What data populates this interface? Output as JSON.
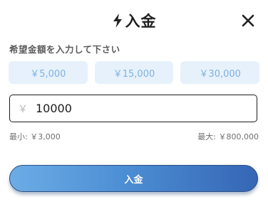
{
  "header": {
    "title": "入金",
    "title_icon": "lightning-bolt-icon",
    "close_icon": "close-icon"
  },
  "prompt": "希望金額を入力して下さい",
  "presets": [
    {
      "label": "￥5,000"
    },
    {
      "label": "￥15,000"
    },
    {
      "label": "￥30,000"
    }
  ],
  "amount": {
    "prefix": "￥",
    "value": "10000"
  },
  "limits": {
    "min": "最小: ￥3,000",
    "max": "最大: ￥800,000"
  },
  "submit_label": "入金",
  "colors": {
    "preset_bg": "#e6f1fb",
    "preset_text": "#7fb1e3",
    "button_gradient_start": "#6cace6",
    "button_gradient_end": "#3566b5"
  }
}
